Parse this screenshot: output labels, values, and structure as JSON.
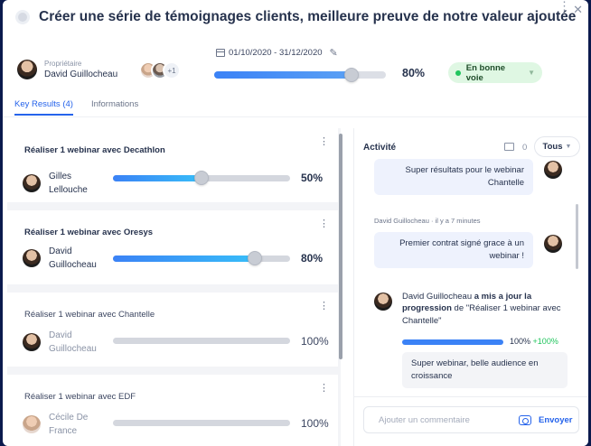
{
  "header": {
    "title": "Créer une série de témoignages clients, meilleure preuve de notre valeur ajoutée",
    "owner_label": "Propriétaire",
    "owner_name": "David Guillocheau",
    "extra_members": "+1",
    "date_range": "01/10/2020 - 31/12/2020",
    "progress": 80,
    "progress_label": "80%",
    "status": "En bonne voie"
  },
  "tabs": [
    {
      "label": "Key Results (4)",
      "active": true
    },
    {
      "label": "Informations",
      "active": false
    }
  ],
  "key_results": [
    {
      "title": "Réaliser 1 webinar avec Decathlon",
      "owner": "Gilles Lellouche",
      "progress": 50,
      "progress_label": "50%",
      "done": false
    },
    {
      "title": "Réaliser 1 webinar avec Oresys",
      "owner": "David Guillocheau",
      "progress": 80,
      "progress_label": "80%",
      "done": false
    },
    {
      "title": "Réaliser 1 webinar avec Chantelle",
      "owner": "David Guillocheau",
      "progress": 100,
      "progress_label": "100%",
      "done": true
    },
    {
      "title": "Réaliser 1 webinar avec EDF",
      "owner": "Cécile De France",
      "progress": 100,
      "progress_label": "100%",
      "done": true
    }
  ],
  "activity": {
    "title": "Activité",
    "image_count": "0",
    "filter": "Tous",
    "message1": "Super résultats pour le webinar Chantelle",
    "meta2": "David Guillocheau · il y a 7 minutes",
    "message2": "Premier contrat signé grace à un webinar !",
    "update_author": "David Guillocheau",
    "update_action": "a mis a jour la progression",
    "update_rest": "de \"Réaliser 1 webinar avec Chantelle\"",
    "update_progress_label": "100%",
    "update_delta": "+100%",
    "update_comment": "Super webinar, belle audience en croissance"
  },
  "comment": {
    "placeholder": "Ajouter un commentaire",
    "send_label": "Envoyer"
  },
  "colors": {
    "accent": "#2563eb",
    "status_bg": "#dff7e3",
    "status_dot": "#22c55e"
  }
}
